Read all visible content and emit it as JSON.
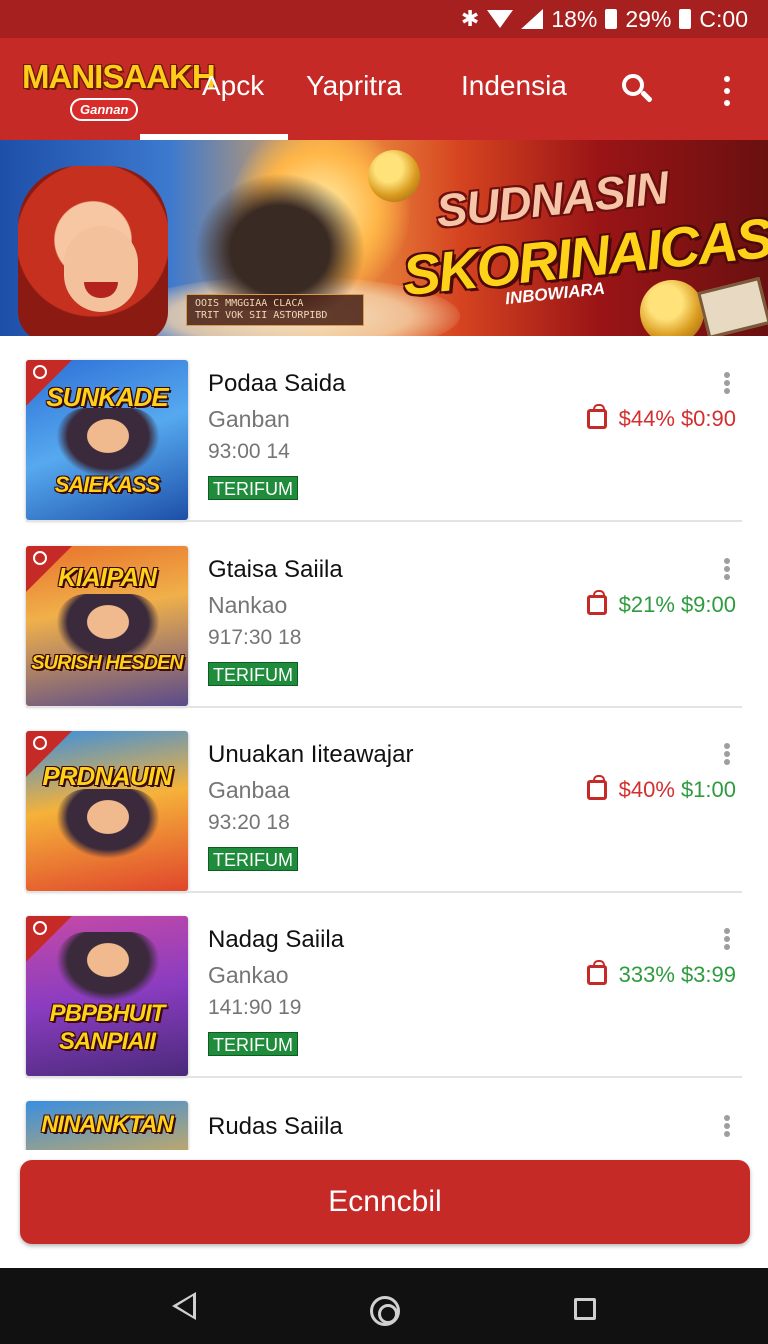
{
  "status_bar": {
    "bluetooth_icon": "bluetooth-icon",
    "wifi_icon": "wifi-icon",
    "signal_icon": "signal-icon",
    "battery1": "18%",
    "battery2": "29%",
    "time": "C:00"
  },
  "app_bar": {
    "logo_text": "MANISAAKH",
    "logo_sub": "Gannan",
    "tabs": [
      {
        "label": "Apck",
        "active": true
      },
      {
        "label": "Yapritra",
        "active": false
      },
      {
        "label": "Indensia",
        "active": false
      }
    ],
    "colors": {
      "primary": "#c62a26",
      "status": "#a5201f"
    }
  },
  "banner": {
    "title_line1": "SUDNASIN",
    "title_line2": "SKORINAICAS",
    "subtitle": "INBOWIARA",
    "plate_line1": "OOIS MMGGIAA  CLACA",
    "plate_line2": "TRIT VOK SII ASTORPIBD"
  },
  "list": [
    {
      "thumb_title_top": "SUNKADE",
      "thumb_title_bottom": "SAIEKASS",
      "name": "Podaa Saida",
      "sub": "Ganban",
      "meta": "93:00 14",
      "badge": "TERIFUM",
      "price_left": "$44%",
      "price_right": "$0:90",
      "price_colors": [
        "#d32f2f",
        "#d32f2f"
      ]
    },
    {
      "thumb_title_top": "KIAIPAN",
      "thumb_title_bottom": "SURISH HESDEN",
      "name": "Gtaisa Saiila",
      "sub": "Nankao",
      "meta": "917:30 18",
      "badge": "TERIFUM",
      "price_left": "$21%",
      "price_right": "$9:00",
      "price_colors": [
        "#2e9b3e",
        "#2e9b3e"
      ]
    },
    {
      "thumb_title_top": "PRDNAUIN",
      "thumb_title_bottom": "",
      "name": "Unuakan Iiteawajar",
      "sub": "Ganbaa",
      "meta": "93:20 18",
      "badge": "TERIFUM",
      "price_left": "$40%",
      "price_right": "$1:00",
      "price_colors": [
        "#d32f2f",
        "#2e9b3e"
      ]
    },
    {
      "thumb_title_top": "",
      "thumb_title_bottom": "PBPBHUIT SANPIAII",
      "name": "Nadag Saiila",
      "sub": "Gankao",
      "meta": "141:90 19",
      "badge": "TERIFUM",
      "price_left": "333%",
      "price_right": "$3:99",
      "price_colors": [
        "#2e9b3e",
        "#2e9b3e"
      ]
    },
    {
      "thumb_title_top": "NINANKTAN",
      "thumb_title_bottom": "",
      "name": "Rudas Saiila",
      "sub": "",
      "meta": "",
      "badge": "",
      "price_left": "",
      "price_right": "",
      "price_colors": [
        "#d32f2f",
        "#d32f2f"
      ]
    }
  ],
  "cta": {
    "label": "Ecnncbil"
  },
  "nav_bar": {
    "back_icon": "back-icon",
    "home_icon": "home-icon",
    "recents_icon": "recents-icon"
  }
}
